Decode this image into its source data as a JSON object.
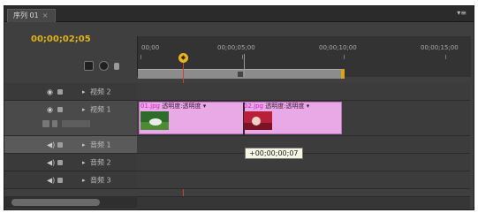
{
  "panel": {
    "tab_label": "序列 01",
    "tab_close": "×",
    "menu_glyph": "▾≡"
  },
  "timecode": "00;00;02;05",
  "ruler": {
    "labels": [
      "00;00",
      "00;00;05;00",
      "00;00;10;00",
      "00;00;15;00"
    ]
  },
  "tracks": {
    "video": [
      {
        "name": "视频 2",
        "eye": "◉"
      },
      {
        "name": "视频 1",
        "eye": "◉"
      }
    ],
    "audio": [
      {
        "name": "音频 1",
        "eye": "◀)"
      },
      {
        "name": "音频 2",
        "eye": "◀)"
      },
      {
        "name": "音频 3",
        "eye": "◀)"
      }
    ],
    "arrow": "▸"
  },
  "clips": [
    {
      "filename": "01.jpg",
      "effect": "透明度:透明度 ▾"
    },
    {
      "filename": "02.jpg",
      "effect": "透明度:透明度 ▾"
    }
  ],
  "tooltip": "+00;00;00;07",
  "colors": {
    "accent_timecode": "#e0b417",
    "clip": "#e8a9e6",
    "playhead": "#c8442c"
  }
}
